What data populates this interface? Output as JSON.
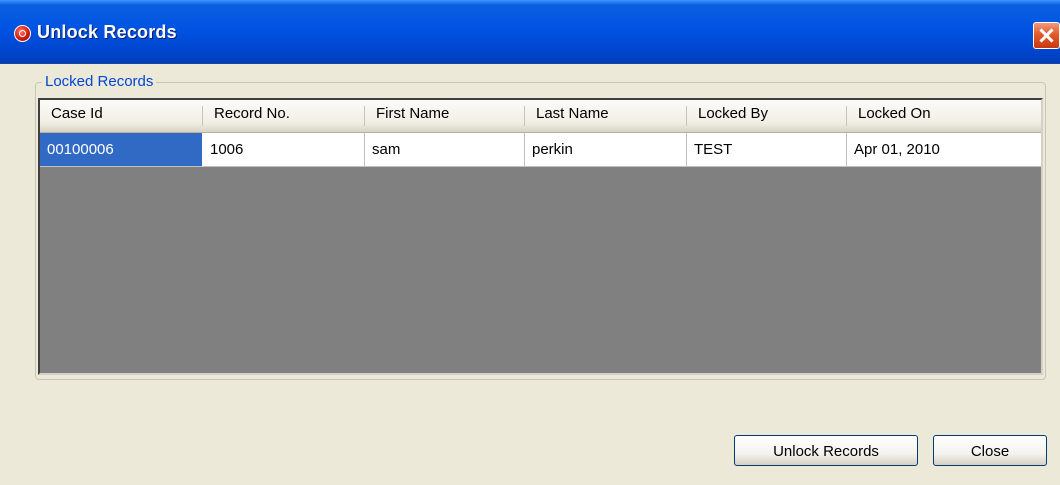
{
  "window": {
    "title": "Unlock Records"
  },
  "group": {
    "label": "Locked Records"
  },
  "table": {
    "columns": [
      "Case Id",
      "Record No.",
      "First Name",
      "Last Name",
      "Locked By",
      "Locked On"
    ],
    "rows": [
      [
        "00100006",
        "1006",
        "sam",
        "perkin",
        "TEST",
        "Apr 01, 2010"
      ]
    ]
  },
  "buttons": {
    "unlock": "Unlock Records",
    "close": "Close"
  },
  "icons": {
    "app": "app-record-icon",
    "close": "close-icon"
  },
  "colors": {
    "titlebar": "#0054e3",
    "selection": "#316ac5",
    "grid_background": "#808080",
    "group_label": "#0046d5"
  }
}
